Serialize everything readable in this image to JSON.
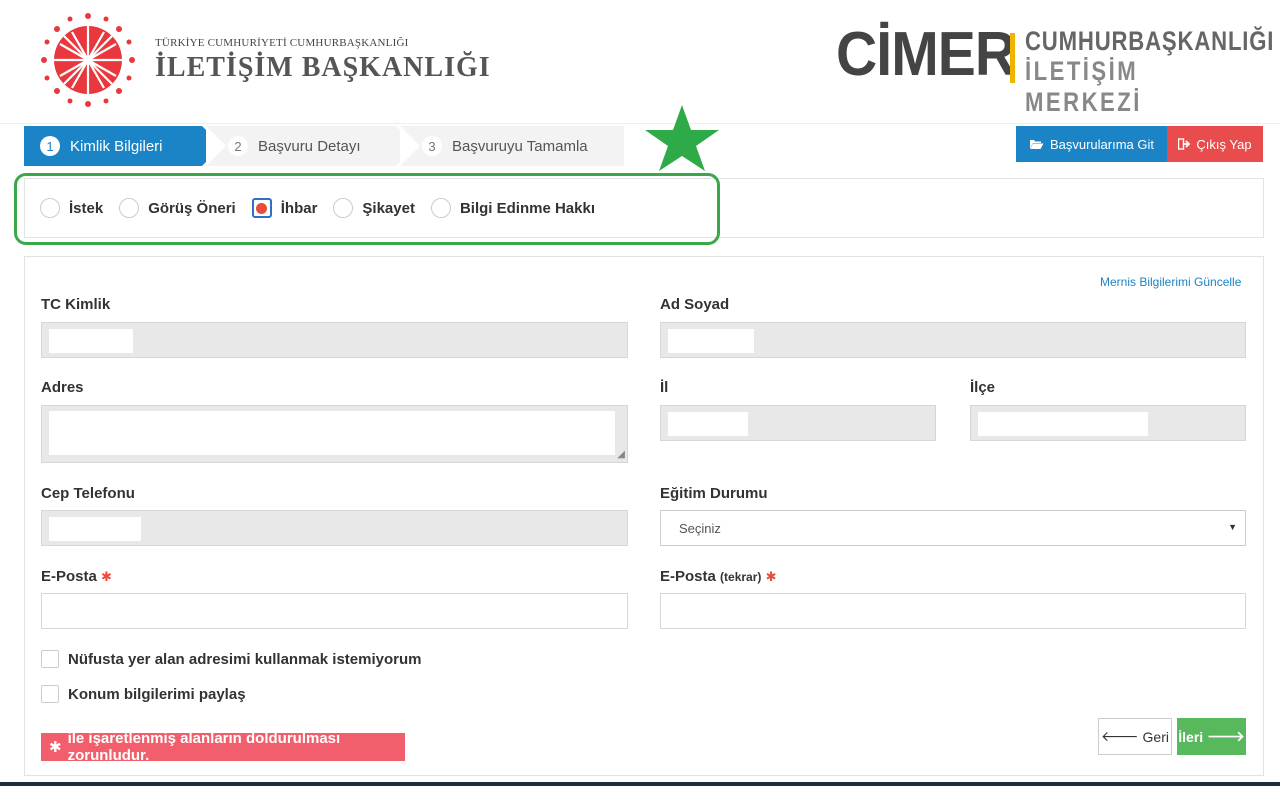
{
  "header": {
    "org_small": "TÜRKİYE CUMHURİYETİ CUMHURBAŞKANLIĞI",
    "org_big": "İLETİŞİM BAŞKANLIĞI",
    "brand": "CİMER",
    "brand_sub1": "CUMHURBAŞKANLIĞI",
    "brand_sub2": "İLETİŞİM MERKEZİ",
    "emblem_icon": "state-emblem-icon"
  },
  "steps": [
    {
      "num": "1",
      "label": "Kimlik Bilgileri",
      "active": true
    },
    {
      "num": "2",
      "label": "Başvuru Detayı",
      "active": false
    },
    {
      "num": "3",
      "label": "Başvuruyu Tamamla",
      "active": false
    }
  ],
  "actions": {
    "my_applications": "Başvurularıma Git",
    "exit": "Çıkış Yap"
  },
  "application_types": [
    {
      "label": "İstek",
      "checked": false
    },
    {
      "label": "Görüş Öneri",
      "checked": false
    },
    {
      "label": "İhbar",
      "checked": true
    },
    {
      "label": "Şikayet",
      "checked": false
    },
    {
      "label": "Bilgi Edinme Hakkı",
      "checked": false
    }
  ],
  "form": {
    "mernis_link": "Mernis Bilgilerimi Güncelle",
    "tc_label": "TC Kimlik",
    "name_label": "Ad Soyad",
    "address_label": "Adres",
    "city_label": "İl",
    "district_label": "İlçe",
    "phone_label": "Cep Telefonu",
    "education_label": "Eğitim Durumu",
    "education_value": "Seçiniz",
    "email_label": "E-Posta",
    "email_repeat_label": "E-Posta",
    "email_repeat_suffix": "(tekrar)",
    "required_mark": "✱",
    "checkbox_address": "Nüfusta yer alan adresimi kullanmak istemiyorum",
    "checkbox_location": "Konum bilgilerimi paylaş",
    "notice": "ile işaretlenmiş alanların doldurulması zorunludur.",
    "back_button": "Geri",
    "next_button": "İleri"
  },
  "colors": {
    "primary": "#1a84c6",
    "danger": "#e84c4c",
    "success": "#57b95c",
    "highlight": "#3aa84a",
    "accent": "#f0b400"
  }
}
